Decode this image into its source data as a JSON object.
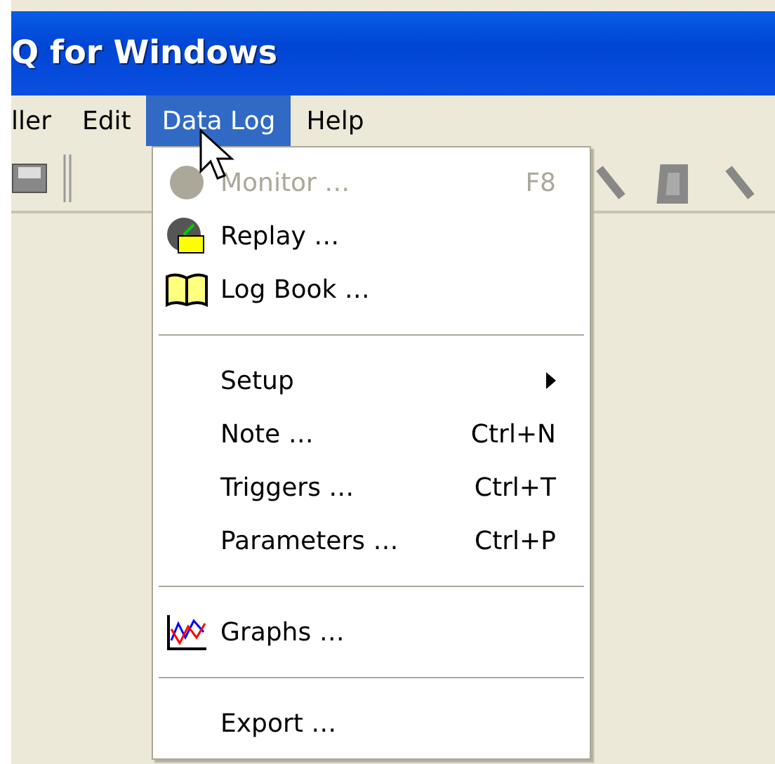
{
  "window": {
    "title": "Q for Windows"
  },
  "menubar": [
    {
      "label": "ller",
      "selected": false
    },
    {
      "label": "Edit",
      "selected": false
    },
    {
      "label": "Data Log",
      "selected": true
    },
    {
      "label": "Help",
      "selected": false
    }
  ],
  "menu": [
    {
      "kind": "item",
      "label": "Monitor …",
      "shortcut": "F8",
      "disabled": true
    },
    {
      "kind": "item",
      "label": "Replay …",
      "disabled": false
    },
    {
      "kind": "item",
      "label": "Log Book …",
      "disabled": false
    },
    {
      "kind": "separator"
    },
    {
      "kind": "submenu",
      "label": "Setup",
      "disabled": false
    },
    {
      "kind": "item",
      "label": "Note …",
      "shortcut": "Ctrl+N",
      "disabled": false
    },
    {
      "kind": "item",
      "label": "Triggers …",
      "shortcut": "Ctrl+T",
      "disabled": false
    },
    {
      "kind": "item",
      "label": "Parameters …",
      "shortcut": "Ctrl+P",
      "disabled": false
    },
    {
      "kind": "separator"
    },
    {
      "kind": "item",
      "label": "Graphs …",
      "disabled": false
    },
    {
      "kind": "separator"
    },
    {
      "kind": "item",
      "label": "Export …",
      "disabled": false
    }
  ]
}
